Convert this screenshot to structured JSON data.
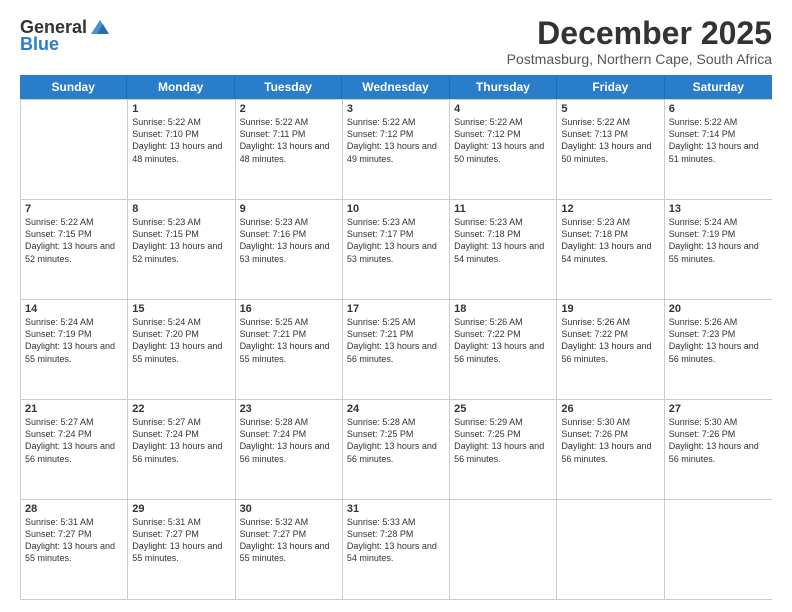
{
  "logo": {
    "general": "General",
    "blue": "Blue"
  },
  "title": "December 2025",
  "location": "Postmasburg, Northern Cape, South Africa",
  "days": [
    "Sunday",
    "Monday",
    "Tuesday",
    "Wednesday",
    "Thursday",
    "Friday",
    "Saturday"
  ],
  "weeks": [
    [
      {
        "day": "",
        "sunrise": "",
        "sunset": "",
        "daylight": ""
      },
      {
        "day": "1",
        "sunrise": "Sunrise: 5:22 AM",
        "sunset": "Sunset: 7:10 PM",
        "daylight": "Daylight: 13 hours and 48 minutes."
      },
      {
        "day": "2",
        "sunrise": "Sunrise: 5:22 AM",
        "sunset": "Sunset: 7:11 PM",
        "daylight": "Daylight: 13 hours and 48 minutes."
      },
      {
        "day": "3",
        "sunrise": "Sunrise: 5:22 AM",
        "sunset": "Sunset: 7:12 PM",
        "daylight": "Daylight: 13 hours and 49 minutes."
      },
      {
        "day": "4",
        "sunrise": "Sunrise: 5:22 AM",
        "sunset": "Sunset: 7:12 PM",
        "daylight": "Daylight: 13 hours and 50 minutes."
      },
      {
        "day": "5",
        "sunrise": "Sunrise: 5:22 AM",
        "sunset": "Sunset: 7:13 PM",
        "daylight": "Daylight: 13 hours and 50 minutes."
      },
      {
        "day": "6",
        "sunrise": "Sunrise: 5:22 AM",
        "sunset": "Sunset: 7:14 PM",
        "daylight": "Daylight: 13 hours and 51 minutes."
      }
    ],
    [
      {
        "day": "7",
        "sunrise": "Sunrise: 5:22 AM",
        "sunset": "Sunset: 7:15 PM",
        "daylight": "Daylight: 13 hours and 52 minutes."
      },
      {
        "day": "8",
        "sunrise": "Sunrise: 5:23 AM",
        "sunset": "Sunset: 7:15 PM",
        "daylight": "Daylight: 13 hours and 52 minutes."
      },
      {
        "day": "9",
        "sunrise": "Sunrise: 5:23 AM",
        "sunset": "Sunset: 7:16 PM",
        "daylight": "Daylight: 13 hours and 53 minutes."
      },
      {
        "day": "10",
        "sunrise": "Sunrise: 5:23 AM",
        "sunset": "Sunset: 7:17 PM",
        "daylight": "Daylight: 13 hours and 53 minutes."
      },
      {
        "day": "11",
        "sunrise": "Sunrise: 5:23 AM",
        "sunset": "Sunset: 7:18 PM",
        "daylight": "Daylight: 13 hours and 54 minutes."
      },
      {
        "day": "12",
        "sunrise": "Sunrise: 5:23 AM",
        "sunset": "Sunset: 7:18 PM",
        "daylight": "Daylight: 13 hours and 54 minutes."
      },
      {
        "day": "13",
        "sunrise": "Sunrise: 5:24 AM",
        "sunset": "Sunset: 7:19 PM",
        "daylight": "Daylight: 13 hours and 55 minutes."
      }
    ],
    [
      {
        "day": "14",
        "sunrise": "Sunrise: 5:24 AM",
        "sunset": "Sunset: 7:19 PM",
        "daylight": "Daylight: 13 hours and 55 minutes."
      },
      {
        "day": "15",
        "sunrise": "Sunrise: 5:24 AM",
        "sunset": "Sunset: 7:20 PM",
        "daylight": "Daylight: 13 hours and 55 minutes."
      },
      {
        "day": "16",
        "sunrise": "Sunrise: 5:25 AM",
        "sunset": "Sunset: 7:21 PM",
        "daylight": "Daylight: 13 hours and 55 minutes."
      },
      {
        "day": "17",
        "sunrise": "Sunrise: 5:25 AM",
        "sunset": "Sunset: 7:21 PM",
        "daylight": "Daylight: 13 hours and 56 minutes."
      },
      {
        "day": "18",
        "sunrise": "Sunrise: 5:26 AM",
        "sunset": "Sunset: 7:22 PM",
        "daylight": "Daylight: 13 hours and 56 minutes."
      },
      {
        "day": "19",
        "sunrise": "Sunrise: 5:26 AM",
        "sunset": "Sunset: 7:22 PM",
        "daylight": "Daylight: 13 hours and 56 minutes."
      },
      {
        "day": "20",
        "sunrise": "Sunrise: 5:26 AM",
        "sunset": "Sunset: 7:23 PM",
        "daylight": "Daylight: 13 hours and 56 minutes."
      }
    ],
    [
      {
        "day": "21",
        "sunrise": "Sunrise: 5:27 AM",
        "sunset": "Sunset: 7:24 PM",
        "daylight": "Daylight: 13 hours and 56 minutes."
      },
      {
        "day": "22",
        "sunrise": "Sunrise: 5:27 AM",
        "sunset": "Sunset: 7:24 PM",
        "daylight": "Daylight: 13 hours and 56 minutes."
      },
      {
        "day": "23",
        "sunrise": "Sunrise: 5:28 AM",
        "sunset": "Sunset: 7:24 PM",
        "daylight": "Daylight: 13 hours and 56 minutes."
      },
      {
        "day": "24",
        "sunrise": "Sunrise: 5:28 AM",
        "sunset": "Sunset: 7:25 PM",
        "daylight": "Daylight: 13 hours and 56 minutes."
      },
      {
        "day": "25",
        "sunrise": "Sunrise: 5:29 AM",
        "sunset": "Sunset: 7:25 PM",
        "daylight": "Daylight: 13 hours and 56 minutes."
      },
      {
        "day": "26",
        "sunrise": "Sunrise: 5:30 AM",
        "sunset": "Sunset: 7:26 PM",
        "daylight": "Daylight: 13 hours and 56 minutes."
      },
      {
        "day": "27",
        "sunrise": "Sunrise: 5:30 AM",
        "sunset": "Sunset: 7:26 PM",
        "daylight": "Daylight: 13 hours and 56 minutes."
      }
    ],
    [
      {
        "day": "28",
        "sunrise": "Sunrise: 5:31 AM",
        "sunset": "Sunset: 7:27 PM",
        "daylight": "Daylight: 13 hours and 55 minutes."
      },
      {
        "day": "29",
        "sunrise": "Sunrise: 5:31 AM",
        "sunset": "Sunset: 7:27 PM",
        "daylight": "Daylight: 13 hours and 55 minutes."
      },
      {
        "day": "30",
        "sunrise": "Sunrise: 5:32 AM",
        "sunset": "Sunset: 7:27 PM",
        "daylight": "Daylight: 13 hours and 55 minutes."
      },
      {
        "day": "31",
        "sunrise": "Sunrise: 5:33 AM",
        "sunset": "Sunset: 7:28 PM",
        "daylight": "Daylight: 13 hours and 54 minutes."
      },
      {
        "day": "",
        "sunrise": "",
        "sunset": "",
        "daylight": ""
      },
      {
        "day": "",
        "sunrise": "",
        "sunset": "",
        "daylight": ""
      },
      {
        "day": "",
        "sunrise": "",
        "sunset": "",
        "daylight": ""
      }
    ]
  ]
}
